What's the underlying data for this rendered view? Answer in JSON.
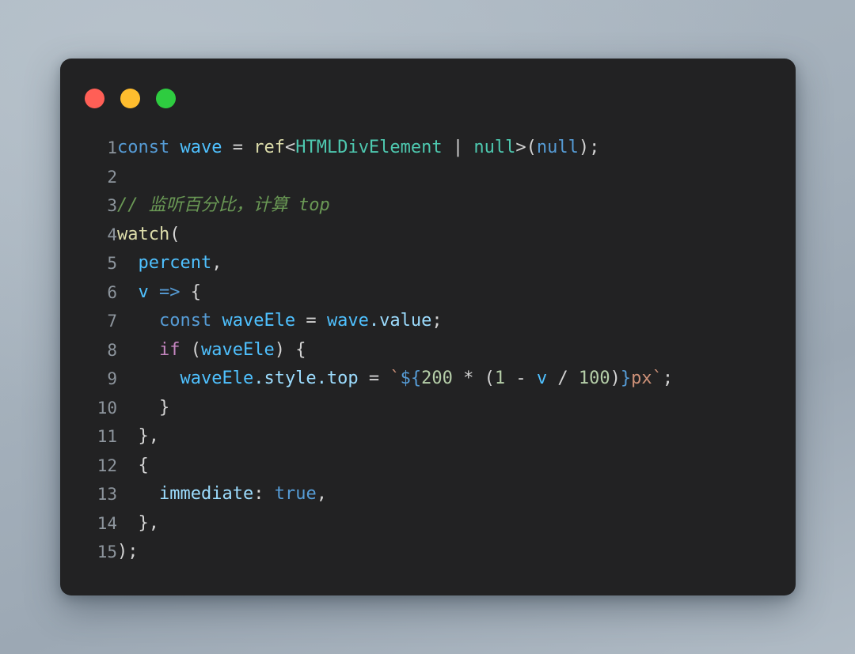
{
  "window": {
    "name": "code-snippet-window",
    "background_panel_color": "#222223",
    "wallpaper_colors": [
      "#b7c2cb",
      "#adb8c3",
      "#9ca8b4"
    ],
    "controls": [
      {
        "name": "close-button",
        "label": "",
        "color": "#ff5f56"
      },
      {
        "name": "minimize-button",
        "label": "",
        "color": "#ffbd2e"
      },
      {
        "name": "maximize-button",
        "label": "",
        "color": "#2ecc40"
      }
    ]
  },
  "editor": {
    "language": "typescript",
    "line_numbers": [
      "1",
      "2",
      "3",
      "4",
      "5",
      "6",
      "7",
      "8",
      "9",
      "10",
      "11",
      "12",
      "13",
      "14",
      "15"
    ],
    "lines": [
      "const wave = ref<HTMLDivElement | null>(null);",
      "",
      "// 监听百分比，计算 top",
      "watch(",
      "  percent,",
      "  v => {",
      "    const waveEle = wave.value;",
      "    if (waveEle) {",
      "      waveEle.style.top = `${200 * (1 - v / 100)}px`;",
      "    }",
      "  },",
      "  {",
      "    immediate: true,",
      "  },",
      ");"
    ],
    "tokens": {
      "l1": {
        "const": "const",
        "wave": "wave",
        "eq": " = ",
        "ref": "ref",
        "lt": "<",
        "htmldivelement": "HTMLDivElement",
        "pipe": " | ",
        "nulltype": "null",
        "gt": ">(",
        "nullvalue": "null",
        "end": ");"
      },
      "l3": {
        "slashes": "// ",
        "comment": "监听百分比，计算 top"
      },
      "l4": {
        "watch": "watch",
        "paren": "("
      },
      "l5": {
        "percent": "percent",
        "comma": ","
      },
      "l6": {
        "v": "v",
        "arrow": " => ",
        "brace": "{"
      },
      "l7": {
        "const": "const",
        "waveEle": " waveEle",
        "eq": " = ",
        "wave": "wave",
        "dotvalue": ".value",
        "semi": ";"
      },
      "l8": {
        "if": "if",
        "open": " (",
        "waveEle": "waveEle",
        "close": ") {"
      },
      "l9": {
        "waveEle": "waveEle",
        "style": ".style",
        "top": ".top",
        "eq": " = ",
        "tick1": "`",
        "interp_open": "${",
        "n200": "200",
        "mul": " * (",
        "n1": "1",
        "minus": " - ",
        "v": "v",
        "div": " / ",
        "n100": "100",
        "closeparen": ")",
        "interp_close": "}",
        "px": "px",
        "tick2": "`",
        "semi": ";"
      },
      "l10": {
        "brace": "}"
      },
      "l11": {
        "brace": "},"
      },
      "l12": {
        "brace": "{"
      },
      "l13": {
        "immediate": "immediate",
        "colon": ": ",
        "true": "true",
        "comma": ","
      },
      "l14": {
        "brace": "},"
      },
      "l15": {
        "end": ");"
      }
    }
  }
}
